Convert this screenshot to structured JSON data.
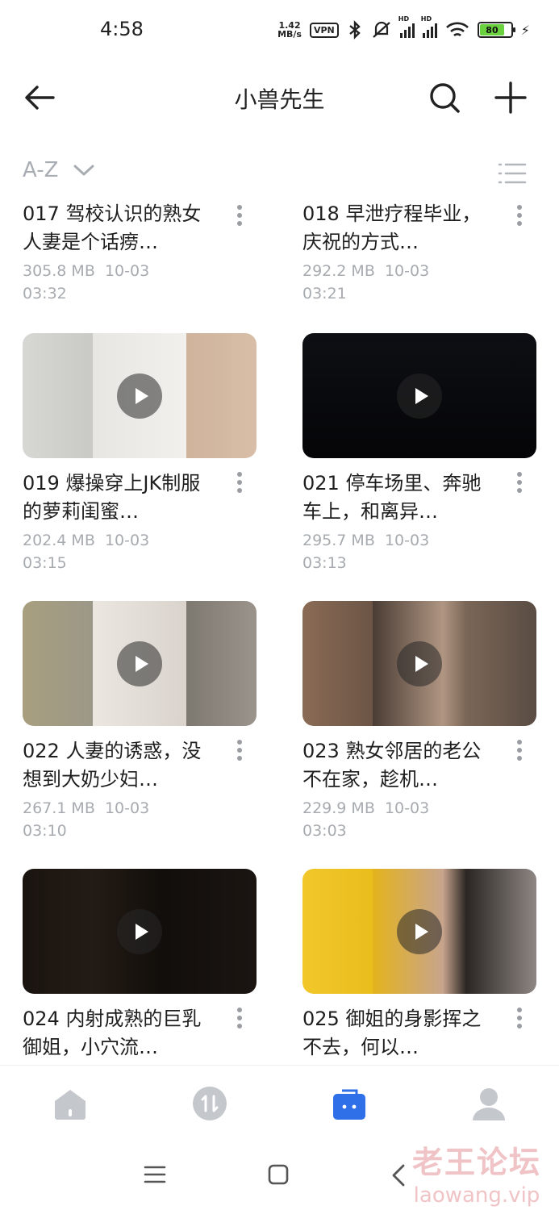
{
  "status_bar": {
    "time": "4:58",
    "speed_value": "1.42",
    "speed_unit": "MB/s",
    "vpn": "VPN",
    "hd1": "HD",
    "hd2": "HD",
    "battery": "80"
  },
  "header": {
    "title": "小兽先生",
    "icons": [
      "back-arrow-icon",
      "search-icon",
      "plus-icon"
    ]
  },
  "sort": {
    "label": "A-Z"
  },
  "items": [
    {
      "title": "017 驾校认识的熟女人妻是个话痨…",
      "size": "305.8 MB",
      "date": "10-03",
      "time": "03:32"
    },
    {
      "title": "018 早泄疗程毕业，庆祝的方式…",
      "size": "292.2 MB",
      "date": "10-03",
      "time": "03:21"
    },
    {
      "title": "019 爆操穿上JK制服的萝莉闺蜜…",
      "size": "202.4 MB",
      "date": "10-03",
      "time": "03:15"
    },
    {
      "title": "021 停车场里、奔驰车上，和离异…",
      "size": "295.7 MB",
      "date": "10-03",
      "time": "03:13"
    },
    {
      "title": "022 人妻的诱惑，没想到大奶少妇…",
      "size": "267.1 MB",
      "date": "10-03",
      "time": "03:10"
    },
    {
      "title": "023 熟女邻居的老公不在家，趁机…",
      "size": "229.9 MB",
      "date": "10-03",
      "time": "03:03"
    },
    {
      "title": "024 内射成熟的巨乳御姐，小穴流…",
      "size": "",
      "date": "",
      "time": ""
    },
    {
      "title": "025 御姐的身影挥之不去，何以…",
      "size": "",
      "date": "",
      "time": ""
    }
  ],
  "tabs": [
    "home-icon",
    "transfer-icon",
    "files-icon",
    "profile-icon"
  ],
  "colors": {
    "accent": "#2f6fe8",
    "tab_inactive": "#c4c7cc",
    "meta_text": "#a7abb0",
    "watermark": "#f0c3c6"
  },
  "watermark": {
    "cn": "老王论坛",
    "en": "laowang.vip"
  }
}
